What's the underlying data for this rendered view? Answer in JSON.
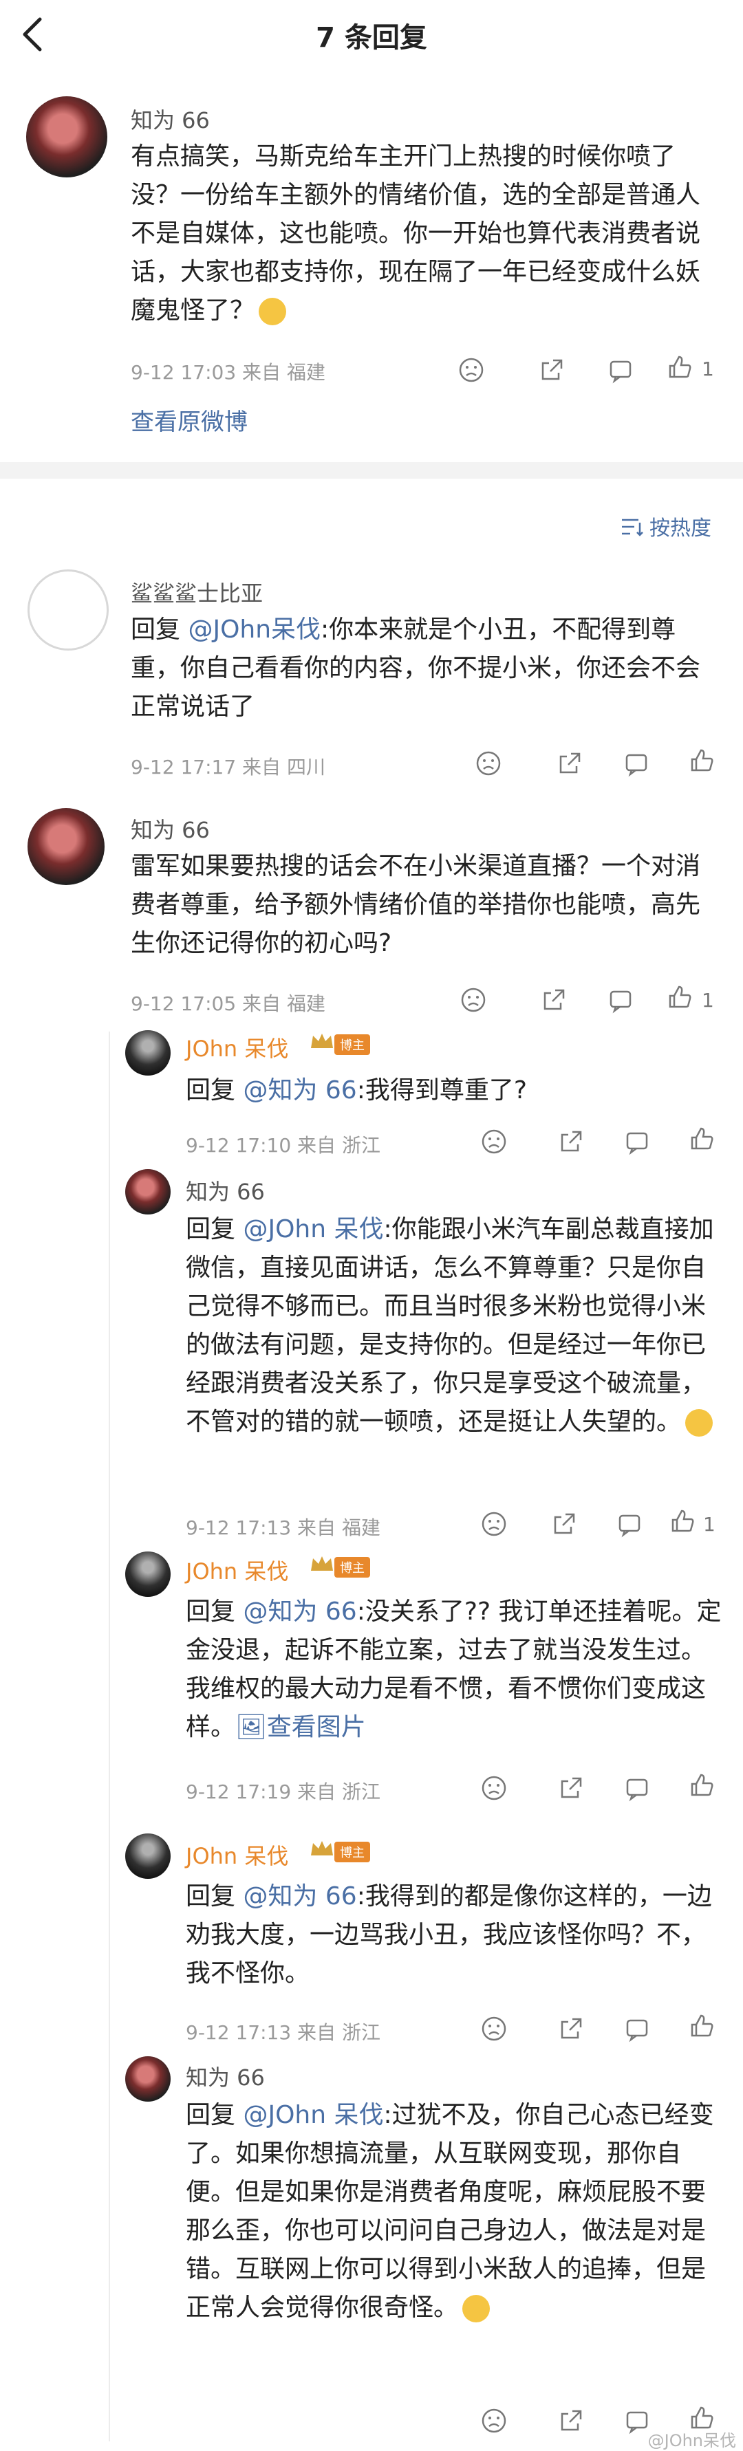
{
  "header": {
    "title": "7 条回复"
  },
  "post": {
    "name": "知为 66",
    "text": "有点搞笑，马斯克给车主开门上热搜的时候你喷了没？一份给车主额外的情绪价值，选的全部是普通人不是自媒体，这也能喷。你一开始也算代表消费者说话，大家也都支持你，现在隔了一年已经变成什么妖魔鬼怪了？",
    "meta": "9-12 17:03  来自 福建",
    "likes": "1",
    "view_original": "查看原微博"
  },
  "sort_label": "按热度",
  "replies": [
    {
      "name": "鲨鲨鲨士比亚",
      "text_prefix": "回复 ",
      "mention": "@JOhn呆伐",
      "text": ":你本来就是个小丑，不配得到尊重，你自己看看你的内容，你不提小米，你还会不会正常说话了",
      "meta": "9-12 17:17  来自 四川"
    },
    {
      "name": "知为 66",
      "text": "雷军如果要热搜的话会不在小米渠道直播？一个对消费者尊重，给予额外情绪价值的举措你也能喷，高先生你还记得你的初心吗?",
      "meta": "9-12 17:05  来自 福建",
      "likes": "1"
    },
    {
      "name": "JOhn 呆伐",
      "badge": "博主",
      "text_prefix": "回复 ",
      "mention": "@知为 66",
      "text": ":我得到尊重了?",
      "meta": "9-12 17:10  来自 浙江"
    },
    {
      "name": "知为 66",
      "text_prefix": "回复 ",
      "mention": "@JOhn 呆伐",
      "text": ":你能跟小米汽车副总裁直接加微信，直接见面讲话，怎么不算尊重？只是你自己觉得不够而已。而且当时很多米粉也觉得小米的做法有问题，是支持你的。但是经过一年你已经跟消费者没关系了，你只是享受这个破流量，不管对的错的就一顿喷，还是挺让人失望的。",
      "meta": "9-12 17:13  来自 福建",
      "likes": "1"
    },
    {
      "name": "JOhn 呆伐",
      "badge": "博主",
      "text_prefix": "回复 ",
      "mention": "@知为 66",
      "text": ":没关系了?? 我订单还挂着呢。定金没退，起诉不能立案，过去了就当没发生过。我维权的最大动力是看不惯，看不惯你们变成这样。",
      "view_image": "查看图片",
      "meta": "9-12 17:19  来自 浙江"
    },
    {
      "name": "JOhn 呆伐",
      "badge": "博主",
      "text_prefix": "回复 ",
      "mention": "@知为 66",
      "text": ":我得到的都是像你这样的，一边劝我大度，一边骂我小丑，我应该怪你吗？不，我不怪你。",
      "meta": "9-12 17:13  来自 浙江"
    },
    {
      "name": "知为 66",
      "text_prefix": "回复 ",
      "mention": "@JOhn 呆伐",
      "text": ":过犹不及，你自己心态已经变了。如果你想搞流量，从互联网变现，那你自便。但是如果你是消费者角度呢，麻烦屁股不要那么歪，你也可以问问自己身边人，做法是对是错。互联网上你可以得到小米敌人的追捧，但是正常人会觉得你很奇怪。"
    }
  ],
  "watermark": "@JOhn呆伐"
}
